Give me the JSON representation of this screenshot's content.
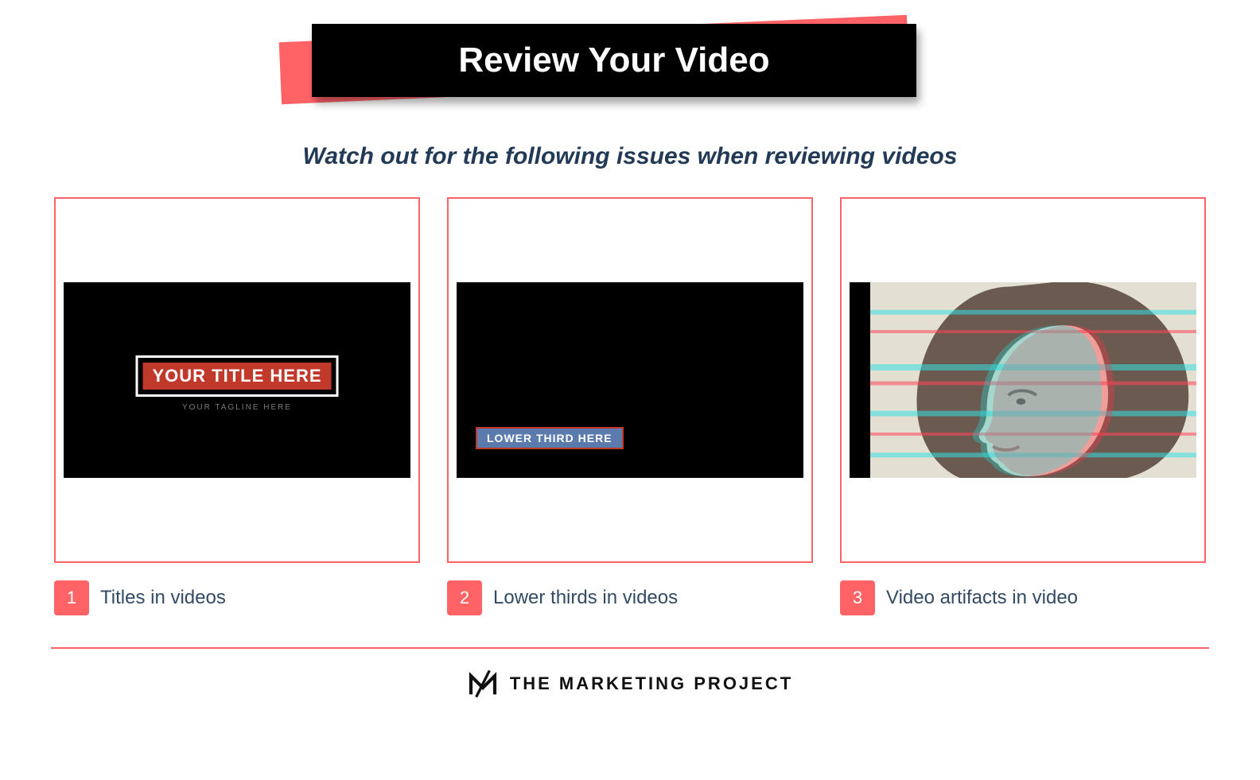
{
  "colors": {
    "accent": "#ff6366",
    "dark": "#000000",
    "text": "#223a55"
  },
  "header": {
    "title": "Review Your Video"
  },
  "subtitle": "Watch out for the following issues when reviewing videos",
  "cards": [
    {
      "num": "1",
      "caption": "Titles in videos",
      "sample": {
        "title": "YOUR TITLE HERE",
        "tagline": "YOUR TAGLINE HERE"
      }
    },
    {
      "num": "2",
      "caption": "Lower thirds in videos",
      "sample": {
        "lower_third": "LOWER THIRD HERE"
      }
    },
    {
      "num": "3",
      "caption": "Video artifacts in video"
    }
  ],
  "footer": {
    "brand": "THE MARKETING PROJECT"
  }
}
